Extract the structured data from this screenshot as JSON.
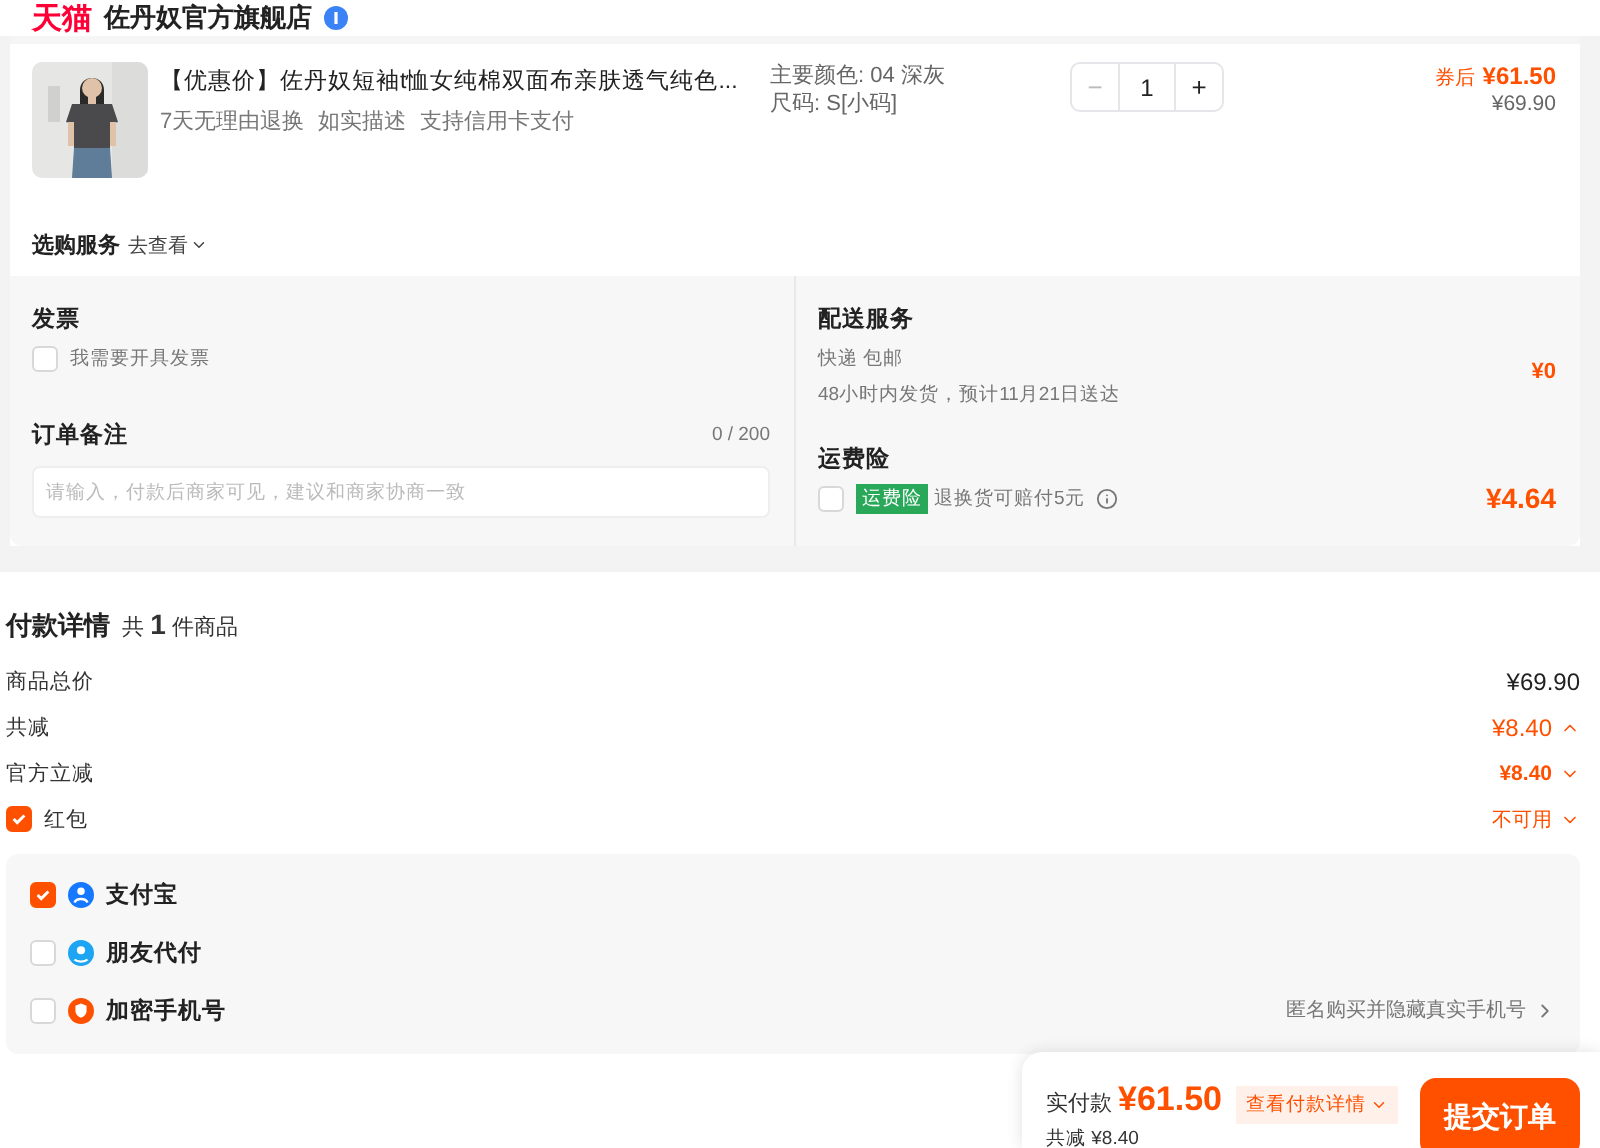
{
  "store": {
    "brand": "天猫",
    "name": "佐丹奴官方旗舰店"
  },
  "product": {
    "title": "【优惠价】佐丹奴短袖t恤女纯棉双面布亲肤透气纯色...",
    "tags": [
      "7天无理由退换",
      "如实描述",
      "支持信用卡支付"
    ],
    "specs": [
      "主要颜色: 04 深灰",
      "尺码: S[小码]"
    ],
    "minus": "−",
    "quantity": "1",
    "plus": "+",
    "coupon_label": "券后",
    "price": "¥61.50",
    "original_price": "¥69.90"
  },
  "purchase_service": {
    "label": "选购服务",
    "link": "去查看"
  },
  "invoice": {
    "title": "发票",
    "option": {
      "label": "我需要开具发票",
      "checked": false
    }
  },
  "note": {
    "title": "订单备注",
    "counter": "0 / 200",
    "placeholder": "请输入，付款后商家可见，建议和商家协商一致"
  },
  "delivery": {
    "title": "配送服务",
    "method": "快递 包邮",
    "eta": "48小时内发货，预计11月21日送达",
    "price": "¥0"
  },
  "insurance": {
    "title": "运费险",
    "checked": false,
    "badge": "运费险",
    "text": "退换货可赔付5元",
    "price": "¥4.64"
  },
  "payment": {
    "title": "付款详情",
    "summary": "共 **1** 件商品",
    "rows": [
      {
        "kind": "total",
        "label": "商品总价",
        "value": "¥69.90"
      },
      {
        "kind": "discount",
        "label": "共减",
        "value": "¥8.40",
        "expanded": true
      },
      {
        "kind": "sub",
        "label": "官方立减",
        "value": "¥8.40",
        "expanded": false
      },
      {
        "kind": "checkbox",
        "label": "红包",
        "value": "不可用",
        "checked": true,
        "expanded": false
      }
    ],
    "methods": [
      {
        "kind": "alipay",
        "label": "支付宝",
        "checked": true
      },
      {
        "kind": "friend",
        "label": "朋友代付",
        "checked": false
      },
      {
        "kind": "phone",
        "label": "加密手机号",
        "checked": false,
        "hint": "匿名购买并隐藏真实手机号"
      }
    ]
  },
  "footer": {
    "label": "实付款",
    "amount": "¥61.50",
    "details": "查看付款详情",
    "saved": "共减 ¥8.40",
    "submit": "提交订单"
  }
}
